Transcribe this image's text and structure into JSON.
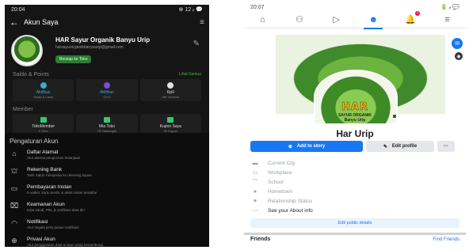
{
  "left": {
    "status": {
      "time": "20:04",
      "indicators": "⊕ 12 ᵢₗ 💬"
    },
    "header": {
      "title": "Akun Saya",
      "back_icon": "arrow-left-icon",
      "menu_icon": "menu-icon"
    },
    "profile": {
      "name": "HAR Sayur Organik Banyu Urip",
      "email": "harsayurorganikbanyuurip@gmail.com",
      "goto_shop": "Bersiap ke Toko"
    },
    "points_section": {
      "title": "Saldo & Points",
      "link": "Lihat Semua"
    },
    "points": [
      {
        "label": "Aktifkan",
        "sub": "Saldo & Lama"
      },
      {
        "label": "Aktifkan",
        "sub": "OVO"
      },
      {
        "label": "Rp0",
        "sub": "Gift Voucher"
      }
    ],
    "member_section": {
      "title": "Member"
    },
    "members": [
      {
        "label": "TokoMember",
        "sub": "0 Toko"
      },
      {
        "label": "Mia Toko",
        "sub": "TB Tantangan"
      },
      {
        "label": "Kupon Saya",
        "sub": "20 Kupon"
      }
    ],
    "settings": {
      "title": "Pengaturan Akun",
      "items": [
        {
          "icon": "home-icon",
          "title": "Daftar Alamat",
          "sub": "Atur alamat pengiriman belanjaan"
        },
        {
          "icon": "bank-icon",
          "title": "Rekening Bank",
          "sub": "Tarik Saldo Tokopedia ke rekening tujuan"
        },
        {
          "icon": "card-icon",
          "title": "Pembayaran Instan",
          "sub": "E-wallet, kartu kredit, & debit instan terdaftar"
        },
        {
          "icon": "lock-icon",
          "title": "Keamanan Akun",
          "sub": "Kata sandi, PIN, & verifikasi data diri"
        },
        {
          "icon": "bell-icon",
          "title": "Notifikasi",
          "sub": "Atur segala jenis pesan notifikasi"
        },
        {
          "icon": "globe-icon",
          "title": "Privasi Akun",
          "sub": "Atur penggunaan data & akun yang tersambung"
        }
      ]
    }
  },
  "right": {
    "status": {
      "time": "20:07",
      "indicators": "🔋 ᵢₗ 💬"
    },
    "nav": [
      {
        "icon": "home-icon",
        "glyph": "⌂"
      },
      {
        "icon": "friends-icon",
        "glyph": "⚇"
      },
      {
        "icon": "video-icon",
        "glyph": "▷"
      },
      {
        "icon": "profile-icon",
        "glyph": "☻"
      },
      {
        "icon": "notifications-icon",
        "glyph": "🔔"
      },
      {
        "icon": "menu-icon",
        "glyph": "≡"
      }
    ],
    "logo": {
      "main": "HAR",
      "sub1": "SAYUR ORGANIK",
      "sub2": "Banyu Urip"
    },
    "page_name": "Har Urip",
    "buttons": {
      "add_story": "Add to story",
      "edit_profile": "Edit profile",
      "more": "···"
    },
    "details": [
      {
        "icon": "briefcase-icon",
        "glyph": "▬",
        "text": "Current City"
      },
      {
        "icon": "workplace-icon",
        "glyph": "▭",
        "text": "Workplace"
      },
      {
        "icon": "school-icon",
        "glyph": "⌒",
        "text": "School"
      },
      {
        "icon": "hometown-icon",
        "glyph": "●",
        "text": "Hometown"
      },
      {
        "icon": "relationship-icon",
        "glyph": "♥",
        "text": "Relationship Status"
      },
      {
        "icon": "more-icon",
        "glyph": "···",
        "text": "See your About info"
      }
    ],
    "edit_public": "Edit public details",
    "friends": {
      "title": "Friends",
      "link": "Find Friends"
    }
  }
}
